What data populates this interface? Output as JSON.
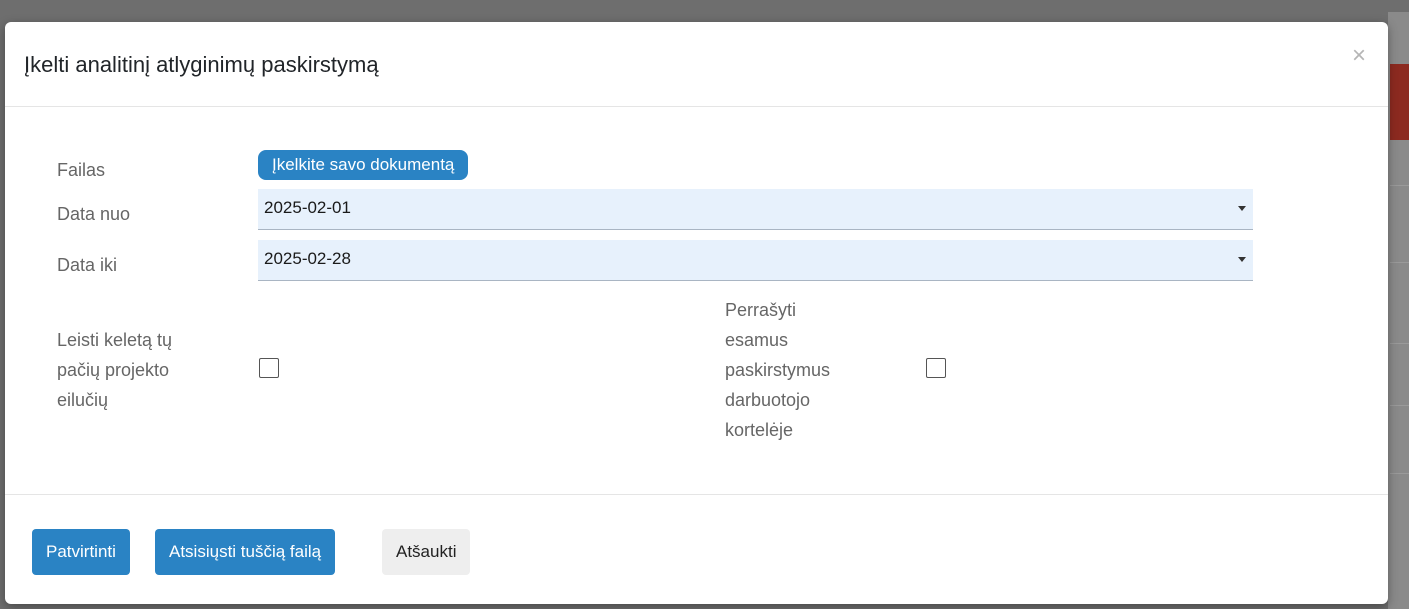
{
  "modal": {
    "title": "Įkelti analitinį atlyginimų paskirstymą",
    "close_glyph": "×"
  },
  "form": {
    "file_label": "Failas",
    "upload_button": "Įkelkite savo dokumentą",
    "date_from_label": "Data nuo",
    "date_from_value": "2025-02-01",
    "date_to_label": "Data iki",
    "date_to_value": "2025-02-28",
    "allow_multiple_label": [
      "Leisti keletą tų",
      "pačių projekto",
      "eilučių"
    ],
    "allow_multiple_checked": false,
    "overwrite_label": [
      "Perrašyti",
      "esamus",
      "paskirstymus",
      "darbuotojo",
      "kortelėje"
    ],
    "overwrite_checked": false
  },
  "footer": {
    "confirm": "Patvirtinti",
    "download_empty": "Atsisiųsti tuščią failą",
    "cancel": "Atšaukti"
  },
  "colors": {
    "primary": "#2a83c4",
    "input_bg": "#e7f1fc"
  },
  "icons": {
    "close": "close-icon",
    "dropdown": "caret-down-icon"
  }
}
